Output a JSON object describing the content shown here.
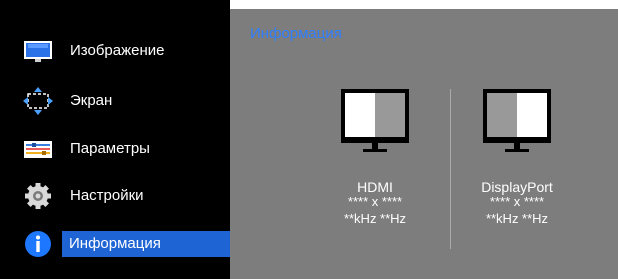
{
  "sidebar": {
    "items": [
      {
        "label": "Изображение",
        "icon": "monitor-icon"
      },
      {
        "label": "Экран",
        "icon": "screen-resize-icon"
      },
      {
        "label": "Параметры",
        "icon": "settings-sliders-icon"
      },
      {
        "label": "Настройки",
        "icon": "gear-icon"
      },
      {
        "label": "Информация",
        "icon": "info-icon",
        "active": true
      }
    ]
  },
  "panel": {
    "title": "Информация",
    "sources": [
      {
        "name": "HDMI",
        "resolution": "**** x ****",
        "rates": "**kHz **Hz",
        "icon": "monitor-left-half-icon"
      },
      {
        "name": "DisplayPort",
        "resolution": "**** x ****",
        "rates": "**kHz **Hz",
        "icon": "monitor-right-half-icon"
      }
    ]
  },
  "colors": {
    "sidebar_bg": "#000000",
    "panel_bg": "#7d7d7d",
    "accent": "#1e64d4",
    "title": "#2f7fff"
  }
}
